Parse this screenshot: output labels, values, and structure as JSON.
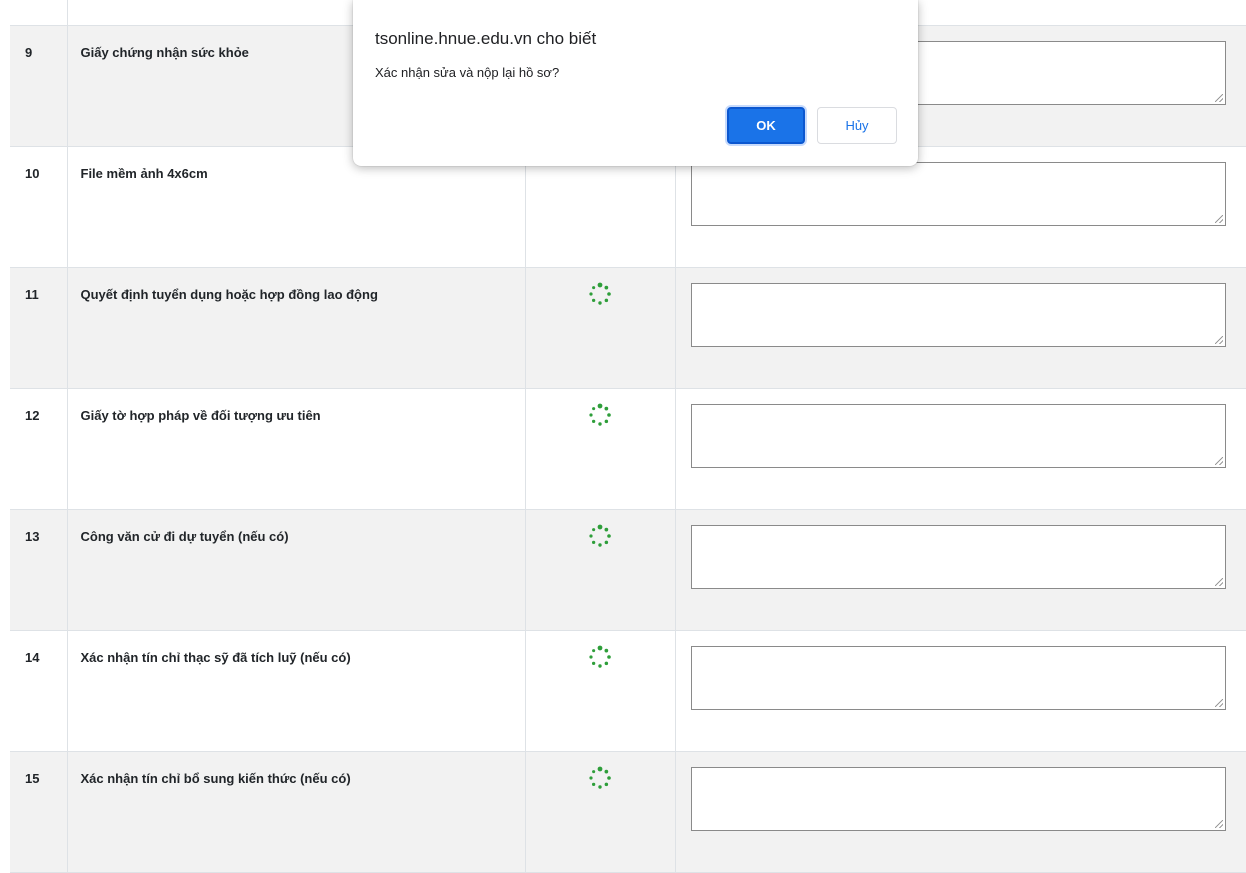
{
  "dialog": {
    "title": "tsonline.hnue.edu.vn cho biết",
    "message": "Xác nhận sửa và nộp lại hồ sơ?",
    "ok_label": "OK",
    "cancel_label": "Hủy"
  },
  "rows": [
    {
      "num": "9",
      "name": "Giấy chứng nhận sức khỏe"
    },
    {
      "num": "10",
      "name": "File mềm ảnh 4x6cm"
    },
    {
      "num": "11",
      "name": "Quyết định tuyển dụng hoặc hợp đồng lao động"
    },
    {
      "num": "12",
      "name": "Giấy tờ hợp pháp về đối tượng ưu tiên"
    },
    {
      "num": "13",
      "name": "Công văn cử đi dự tuyển (nếu có)"
    },
    {
      "num": "14",
      "name": "Xác nhận tín chỉ thạc sỹ đã tích luỹ (nếu có)"
    },
    {
      "num": "15",
      "name": "Xác nhận tín chỉ bổ sung kiến thức (nếu có)"
    }
  ],
  "colors": {
    "spinner": "#2e9e3a",
    "shade": "#f2f2f2",
    "ok": "#1a73e8"
  }
}
